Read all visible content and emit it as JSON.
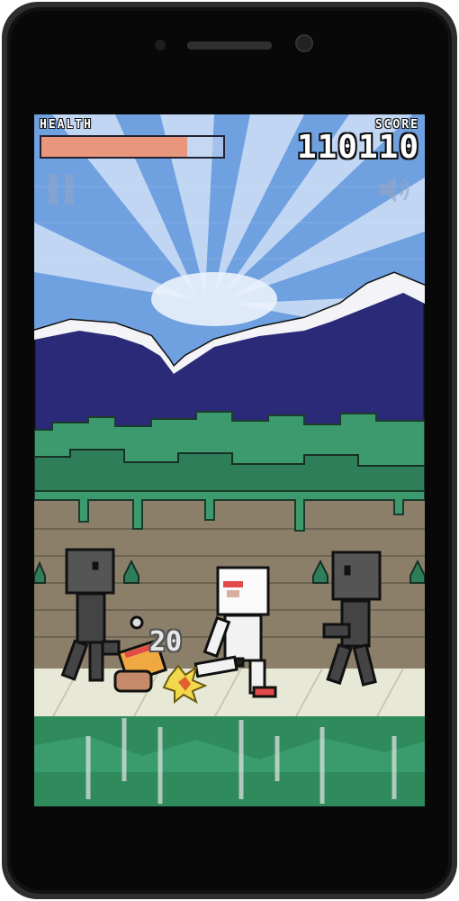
{
  "hud": {
    "health_label": "HEALTH",
    "health_level": 0.8,
    "score_label": "SCORE",
    "score_value": "110110"
  },
  "controls": {
    "pause_icon": "pause-icon",
    "sound_icon": "speaker-icon"
  },
  "combo_text": "20",
  "colors": {
    "sky": "#6fa0e0",
    "mountains": "#2a2a78",
    "snow": "#ffffff",
    "hedge": "#3c9a6e",
    "wall": "#8b7f6a",
    "floor": "#e8e8d6",
    "health_fill": "#e8977c"
  }
}
